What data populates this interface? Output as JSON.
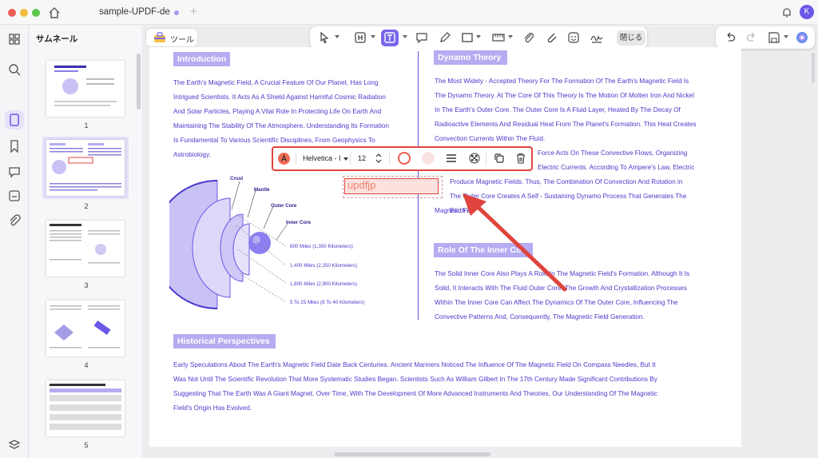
{
  "window": {
    "tab_title": "sample-UPDF-de",
    "avatar_initial": "K"
  },
  "sidebar": {
    "panel_title": "サムネール",
    "page_numbers": [
      "1",
      "2",
      "3",
      "4",
      "5"
    ],
    "selected_page": "2"
  },
  "toolbar": {
    "tool_label": "ツール",
    "close_label": "閉じる"
  },
  "format_bar": {
    "font": "Helvetica - I",
    "size": "12"
  },
  "textbox": {
    "value": "updfjp"
  },
  "document": {
    "intro_header": "Introduction",
    "intro_lines": [
      "The Earth's Magnetic Field, A Crucial Feature Of Our Planet, Has Long",
      "Intrigued Scientists. It Acts As A Shield Against Harmful Cosmic Radiation",
      "And Solar Particles, Playing A Vital Role In Protecting Life On Earth And",
      "Maintaining The Stability Of The Atmosphere. Understanding Its Formation",
      "Is Fundamental To Various Scientific Disciplines, From Geophysics To",
      "Astrobiology."
    ],
    "dynamo_header": "Dynamo Theory",
    "dynamo_lines": [
      "The Most Widely - Accepted Theory For The Formation Of The Earth's Magnetic Field Is",
      "The Dynamo Theory. At The Core Of This Theory Is The Motion Of Molten Iron And Nickel",
      "In The Earth's Outer Core. The Outer Core Is A Fluid Layer, Heated By The Decay Of",
      "Radioactive Elements And Residual Heat From The Planet's Formation. This Heat Creates",
      "Convection Currents Within The Fluid.",
      "Force Acts On These Convective Flows, Organizing",
      "Electric Currents. According To Ampere's Law, Electric",
      "Produce Magnetic Fields. Thus, The Combination Of Convection And Rotation in",
      "The Outer Core Creates A Self - Sustaining Dynamo Process That Generates The Earth's",
      "Magnetic Fi"
    ],
    "inner_core_header": "Role Of The Inner Co",
    "inner_core_lines": [
      "The Solid Inner Core Also Plays A Role In The Magnetic Field's Formation. Although It Is",
      "Solid, It Interacts With The Fluid Outer Core. The Growth And Crystallization Processes",
      "Within The Inner Core Can Affect The Dynamics Of The Outer Core, Influencing The",
      "Convective Patterns And, Consequently, The Magnetic Field Generation."
    ],
    "history_header": "Historical Perspectives",
    "history_lines": [
      "Early Speculations About The Earth's Magnetic Field Date Back Centuries. Ancient Mariners Noticed The Influence Of The Magnetic Field On Compass Needles, But It",
      "Was Not Until The Scientific Revolution That More Systematic Studies Began. Scientists Such As William Gilbert In The 17th Century Made Significant Contributions By",
      "Suggesting That The Earth Was A Giant Magnet. Over Time, With The Development Of More Advanced Instruments And Theories, Our Understanding Of The Magnetic",
      "Field's Origin Has Evolved."
    ],
    "diagram": {
      "layers": [
        "Crust",
        "Mantle",
        "Outer Core",
        "Inner Core"
      ],
      "depths": [
        "800 Miles (1,300 Kilometers)",
        "1,400 Miles (2,250 Kilometers)",
        "1,800 Miles (2,900 Kilometers)",
        "5 To 25 Miles (8 To 40 Kilometers)"
      ]
    }
  },
  "colors": {
    "accent": "#7866ec",
    "text_purple": "#4a3aca",
    "header_bg": "#b5acf1",
    "highlight_red": "#e0443e"
  }
}
